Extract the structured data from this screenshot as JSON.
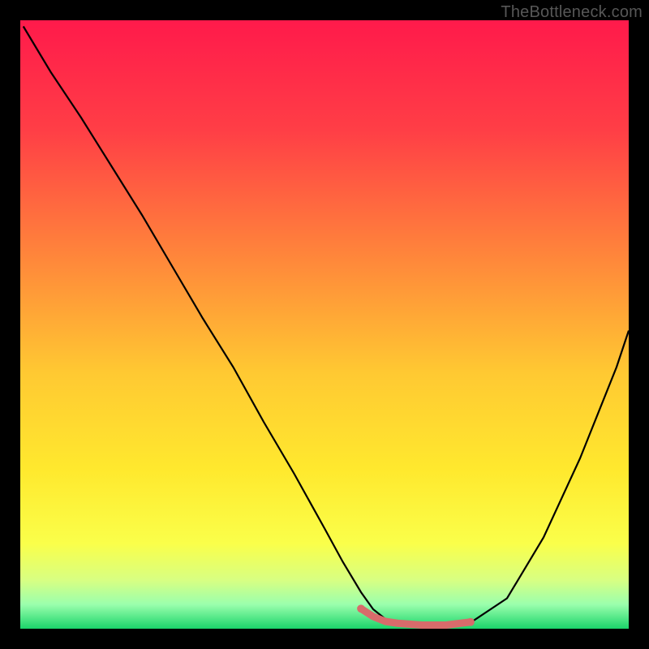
{
  "watermark": "TheBottleneck.com",
  "chart_data": {
    "type": "line",
    "title": "",
    "xlabel": "",
    "ylabel": "",
    "xlim": [
      0,
      100
    ],
    "ylim": [
      0,
      100
    ],
    "gradient_stops": [
      {
        "offset": 0,
        "color": "#ff1a4b"
      },
      {
        "offset": 18,
        "color": "#ff3e46"
      },
      {
        "offset": 40,
        "color": "#ff8a3a"
      },
      {
        "offset": 58,
        "color": "#ffc932"
      },
      {
        "offset": 74,
        "color": "#ffe92e"
      },
      {
        "offset": 86,
        "color": "#faff4a"
      },
      {
        "offset": 92,
        "color": "#d8ff82"
      },
      {
        "offset": 96,
        "color": "#9bffad"
      },
      {
        "offset": 100,
        "color": "#1bd46a"
      }
    ],
    "series": [
      {
        "name": "bottleneck-curve",
        "color": "#000000",
        "width": 2.2,
        "x": [
          0.5,
          5,
          10,
          15,
          20,
          25,
          30,
          35,
          40,
          45,
          50,
          53,
          56,
          58,
          60,
          62,
          66,
          70,
          74,
          80,
          86,
          92,
          98,
          100
        ],
        "y": [
          99,
          91.5,
          84,
          76,
          68,
          59.5,
          51,
          43,
          34,
          25.5,
          16.5,
          11,
          6,
          3.2,
          1.6,
          0.9,
          0.4,
          0.4,
          1.0,
          5,
          15,
          28,
          43,
          49
        ]
      }
    ],
    "highlight_segment": {
      "name": "optimal-range",
      "color": "#d86b6b",
      "width": 9,
      "x": [
        56,
        58,
        60,
        62,
        66,
        70,
        74
      ],
      "y": [
        3.3,
        2.0,
        1.2,
        0.9,
        0.6,
        0.6,
        1.1
      ]
    }
  }
}
